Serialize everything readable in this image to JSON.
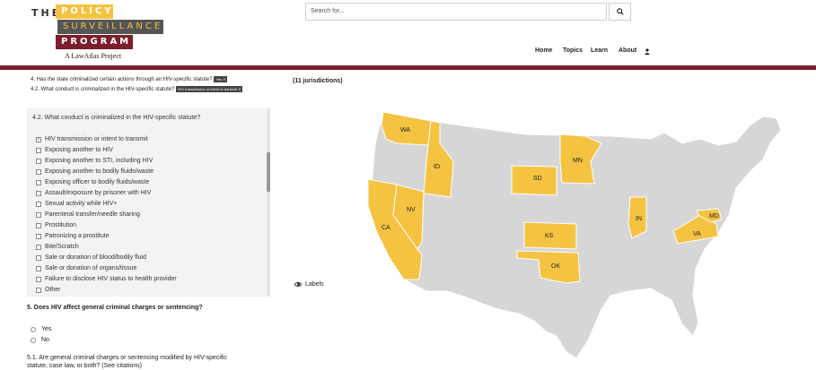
{
  "logo": {
    "the": "THE",
    "policy": "POLICY",
    "surveillance": "SURVEILLANCE",
    "program": "PROGRAM",
    "subtitle": "A LawAtlas Project"
  },
  "search": {
    "placeholder": "Search for..."
  },
  "nav": {
    "home": "Home",
    "topics": "Topics",
    "learn": "Learn",
    "about": "About"
  },
  "questions": {
    "q4": "4. Has the state criminalized certain actions through an HIV-specific statute?",
    "q4_tag": "Yes",
    "q42": "4.2. What conduct is criminalized in the HIV-specific statute?",
    "q42_tag": "HIV transmission or intent to transmit",
    "subquestion": "4.2. What conduct is criminalized in the HIV-specific statute?",
    "options": [
      {
        "label": "HIV transmission or intent to transmit",
        "checked": true
      },
      {
        "label": "Exposing another to HIV",
        "checked": false
      },
      {
        "label": "Exposing another to STI, including HIV",
        "checked": false
      },
      {
        "label": "Exposing another to bodily fluids/waste",
        "checked": false
      },
      {
        "label": "Exposing officer to bodily fluids/waste",
        "checked": false
      },
      {
        "label": "Assault/exposure by prisoner with HIV",
        "checked": false
      },
      {
        "label": "Sexual activity while HIV+",
        "checked": false
      },
      {
        "label": "Parenteral transfer/needle sharing",
        "checked": false
      },
      {
        "label": "Prostitution",
        "checked": false
      },
      {
        "label": "Patronizing a prostitute",
        "checked": false
      },
      {
        "label": "Bite/Scratch",
        "checked": false
      },
      {
        "label": "Sale or donation of blood/bodily fluid",
        "checked": false
      },
      {
        "label": "Sale or donation of organs/tissue",
        "checked": false
      },
      {
        "label": "Failure to disclose HIV status to health provider",
        "checked": false
      },
      {
        "label": "Other",
        "checked": false
      }
    ],
    "q5": "5. Does HIV affect general criminal charges or sentencing?",
    "q5_yes": "Yes",
    "q5_no": "No",
    "q51": "5.1. Are general criminal charges or sentencing modified by HIV-specific statute, case law, or both? (See citations)"
  },
  "map": {
    "jurisdictions": "(11 jurisdictions)",
    "labels_toggle": "Labels",
    "highlight_color": "#f5c342",
    "base_color": "#d6d6d6",
    "highlighted_states": [
      "WA",
      "ID",
      "NV",
      "CA",
      "SD",
      "MN",
      "KS",
      "OK",
      "IN",
      "VA",
      "MD"
    ]
  }
}
